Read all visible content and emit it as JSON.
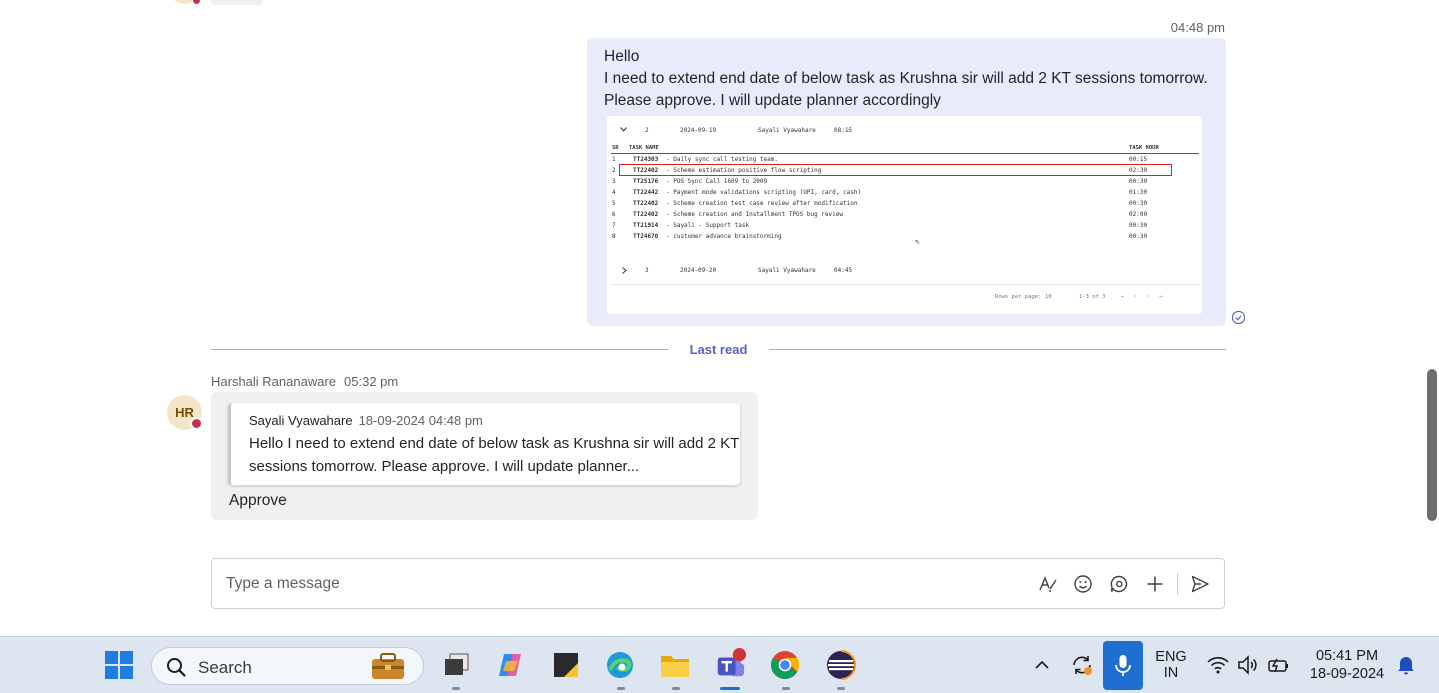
{
  "own_message": {
    "time": "04:48 pm",
    "lines": [
      "Hello",
      "I need to extend end date of below task as Krushna sir will add 2 KT sessions tomorrow.",
      "Please approve. I will update planner accordingly"
    ],
    "attachment": {
      "group_top": {
        "sr": "2",
        "date": "2024-09-19",
        "name": "Sayali Vyawahare",
        "hours": "08:15"
      },
      "columns": {
        "sr": "SR",
        "task": "TASK NAME",
        "hour": "TASK HOUR"
      },
      "rows": [
        {
          "sr": "1",
          "id": "TT24303",
          "desc": "- Daily sync call testing team.",
          "hour": "00:15"
        },
        {
          "sr": "2",
          "id": "TT22402",
          "desc": "- Scheme estimation positive flow scripting",
          "hour": "02:30"
        },
        {
          "sr": "3",
          "id": "TT25176",
          "desc": "- POS Sync Call 1609 to 2009",
          "hour": "00:30"
        },
        {
          "sr": "4",
          "id": "TT22442",
          "desc": "- Payment mode validations scripting (UPI, card, cash)",
          "hour": "01:30"
        },
        {
          "sr": "5",
          "id": "TT22402",
          "desc": "- Scheme creation test case review after modification",
          "hour": "00:30"
        },
        {
          "sr": "6",
          "id": "TT22402",
          "desc": "- Scheme creation and Installment TPOS bug review",
          "hour": "02:00"
        },
        {
          "sr": "7",
          "id": "TT21914",
          "desc": "- Sayali - Support task",
          "hour": "00:30"
        },
        {
          "sr": "8",
          "id": "TT24670",
          "desc": "- customer advance brainstorming",
          "hour": "00:30"
        }
      ],
      "group_bottom": {
        "sr": "3",
        "date": "2024-09-20",
        "name": "Sayali Vyawahare",
        "hours": "04:45"
      },
      "pager": {
        "rows_label": "Rows per page:",
        "rows_value": "10",
        "range": "1-3 of 3"
      }
    }
  },
  "last_read_label": "Last read",
  "reply": {
    "avatar_initials": "HR",
    "sender": "Harshali Rananaware",
    "time": "05:32 pm",
    "quote_author": "Sayali Vyawahare",
    "quote_time": "18-09-2024 04:48 pm",
    "quote_text": "Hello I need to extend end date of below task as Krushna sir will add 2 KT sessions tomorrow. Please approve. I will update planner...",
    "text": "Approve"
  },
  "compose": {
    "placeholder": "Type a message",
    "tools": [
      "format-icon",
      "emoji-icon",
      "loop-icon",
      "add-icon",
      "send-icon"
    ]
  },
  "taskbar": {
    "search_label": "Search",
    "apps": [
      "work-briefcase-icon",
      "task-view-icon",
      "copilot-icon",
      "sticky-notes-icon",
      "edge-icon",
      "file-explorer-icon",
      "teams-icon",
      "chrome-icon",
      "eclipse-icon"
    ],
    "language_line1": "ENG",
    "language_line2": "IN",
    "clock_time": "05:41 PM",
    "clock_date": "18-09-2024"
  },
  "colors": {
    "accent": "#5b5fc7",
    "own_bubble": "#e8ebfa",
    "other_bubble": "#f0f0f0",
    "presence_busy": "#c4314b",
    "taskbar": "#dce5f0"
  }
}
